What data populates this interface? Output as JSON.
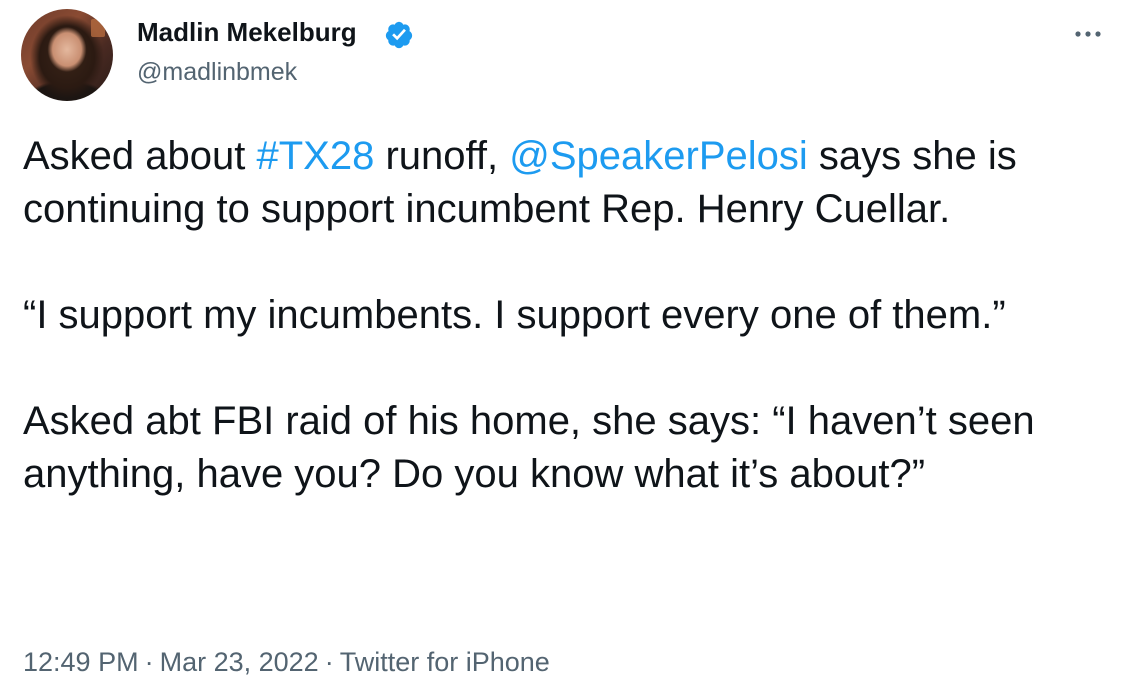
{
  "author": {
    "display_name": "Madlin Mekelburg",
    "handle": "@madlinbmek",
    "verified_icon": "verified-badge-icon",
    "avatar_icon": "user-avatar"
  },
  "menu": {
    "icon": "more-horizontal-icon"
  },
  "tweet": {
    "p1": {
      "t1": "Asked about ",
      "hashtag": "#TX28",
      "t2": " runoff, ",
      "mention": "@SpeakerPelosi",
      "t3": " says she is continuing to support incumbent Rep. Henry Cuellar."
    },
    "p2": "“I support my incumbents. I support every one of them.”",
    "p3": "Asked abt FBI raid of his home, she says: “I haven’t seen anything, have you? Do you know what it’s about?”"
  },
  "meta": {
    "time": "12:49 PM",
    "date": "Mar 23, 2022",
    "source": "Twitter for iPhone",
    "separator": "·"
  },
  "colors": {
    "link": "#1d9bf0",
    "text": "#0f1419",
    "secondary": "#536471"
  }
}
